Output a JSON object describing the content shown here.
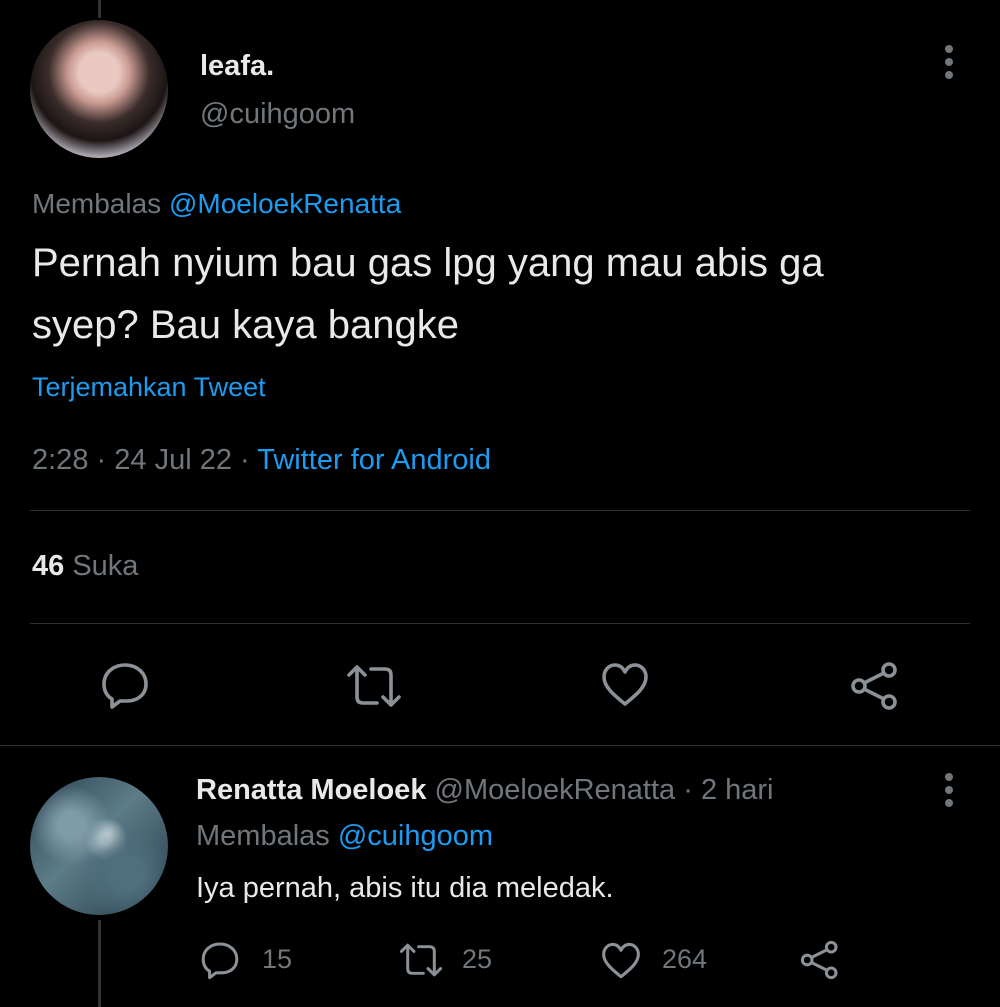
{
  "tweet": {
    "author_name": "leafa.",
    "author_handle": "@cuihgoom",
    "reply_prefix": "Membalas",
    "reply_to": "@MoeloekRenatta",
    "text_line1": "Pernah nyium bau gas lpg yang mau abis ga",
    "text_line2": "syep? Bau kaya bangke",
    "translate": "Terjemahkan Tweet",
    "time": "2:28",
    "dot1": "·",
    "date": "24 Jul 22",
    "dot2": "·",
    "source": "Twitter for Android",
    "likes_count": "46",
    "likes_label": "Suka"
  },
  "reply": {
    "author_name": "Renatta Moeloek",
    "author_handle": "@MoeloekRenatta",
    "dot": "·",
    "time": "2 hari",
    "reply_prefix": "Membalas",
    "reply_to": "@cuihgoom",
    "text": "Iya pernah, abis itu dia meledak.",
    "replies": "15",
    "retweets": "25",
    "likes": "264"
  },
  "colors": {
    "background": "#000000",
    "link": "#1d9bf0",
    "muted": "#71767b",
    "text": "#d9d9d9"
  },
  "icons": [
    "more-icon",
    "reply-icon",
    "retweet-icon",
    "like-icon",
    "share-icon"
  ]
}
